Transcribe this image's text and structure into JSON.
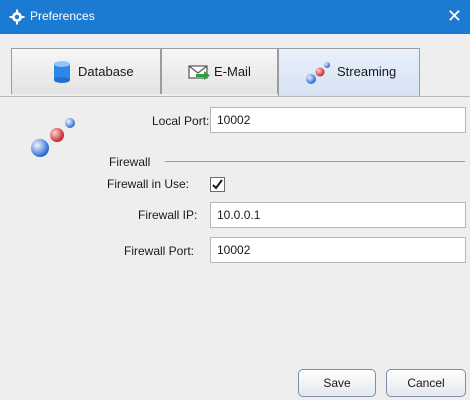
{
  "window": {
    "title": "Preferences",
    "close_glyph": "✕",
    "app_icon": "gear-icon"
  },
  "tabs": [
    {
      "label": "Database",
      "icon": "database-icon",
      "active": false
    },
    {
      "label": "E-Mail",
      "icon": "email-arrow-icon",
      "active": false
    },
    {
      "label": "Streaming",
      "icon": "streaming-spheres-icon",
      "active": true
    }
  ],
  "form": {
    "local_port": {
      "label": "Local Port:",
      "value": "10002"
    },
    "firewall_section": "Firewall",
    "firewall_in_use": {
      "label": "Firewall in Use:",
      "checked": true
    },
    "firewall_ip": {
      "label": "Firewall IP:",
      "value": "10.0.0.1"
    },
    "firewall_port": {
      "label": "Firewall Port:",
      "value": "10002"
    }
  },
  "buttons": {
    "save": "Save",
    "cancel": "Cancel"
  },
  "colors": {
    "titlebar": "#1b7bd3",
    "active_tab": "#d6e2f3",
    "background": "#eeeeee"
  }
}
